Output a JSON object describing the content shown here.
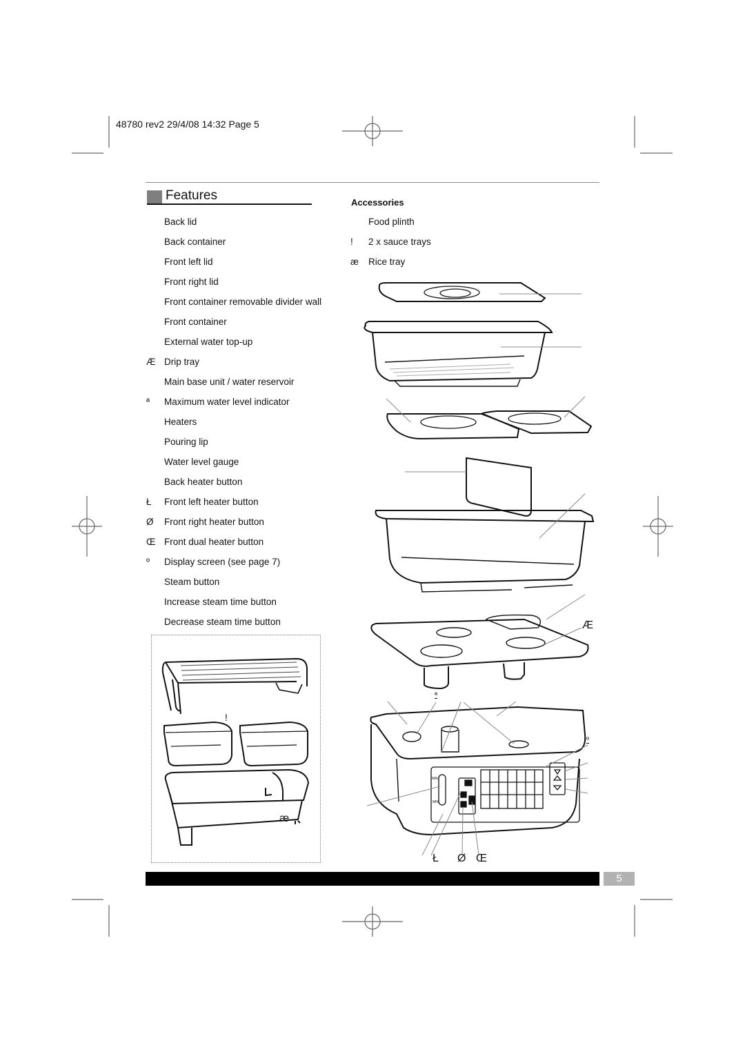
{
  "slug": "48780 rev2  29/4/08  14:32  Page 5",
  "features": {
    "title": "Features",
    "items": [
      {
        "marker": "",
        "label": "Back lid"
      },
      {
        "marker": "",
        "label": "Back container"
      },
      {
        "marker": "",
        "label": "Front left lid"
      },
      {
        "marker": "",
        "label": "Front right lid"
      },
      {
        "marker": "",
        "label": "Front container removable divider wall"
      },
      {
        "marker": "",
        "label": "Front container"
      },
      {
        "marker": "",
        "label": "External water top-up"
      },
      {
        "marker": "Æ",
        "label": "Drip tray"
      },
      {
        "marker": "",
        "label": "Main base unit / water reservoir"
      },
      {
        "marker": "ª",
        "label": "Maximum water level indicator"
      },
      {
        "marker": "",
        "label": "Heaters"
      },
      {
        "marker": "",
        "label": "Pouring lip"
      },
      {
        "marker": "",
        "label": "Water level gauge"
      },
      {
        "marker": "",
        "label": "Back heater button"
      },
      {
        "marker": "Ł",
        "label": "Front left heater button"
      },
      {
        "marker": "Ø",
        "label": "Front right heater button"
      },
      {
        "marker": "Œ",
        "label": "Front dual heater button"
      },
      {
        "marker": "º",
        "label": "Display screen (see page 7)"
      },
      {
        "marker": "",
        "label": "Steam button"
      },
      {
        "marker": "",
        "label": "Increase steam time button"
      },
      {
        "marker": "",
        "label": "Decrease steam time button"
      }
    ]
  },
  "accessories": {
    "title": "Accessories",
    "items": [
      {
        "marker": "",
        "label": "Food plinth"
      },
      {
        "marker": "!",
        "label": "2 x sauce trays"
      },
      {
        "marker": "æ",
        "label": "Rice tray"
      }
    ]
  },
  "callouts": {
    "drip_tray": "Æ",
    "max_level": "ª",
    "display": "º",
    "front_left_btn": "Ł",
    "front_right_btn": "Ø",
    "front_dual_btn": "Œ",
    "sauce_trays": "!",
    "rice_tray": "æ"
  },
  "gauge": {
    "max": "MAX",
    "min": "MIN"
  },
  "page_number": "5"
}
